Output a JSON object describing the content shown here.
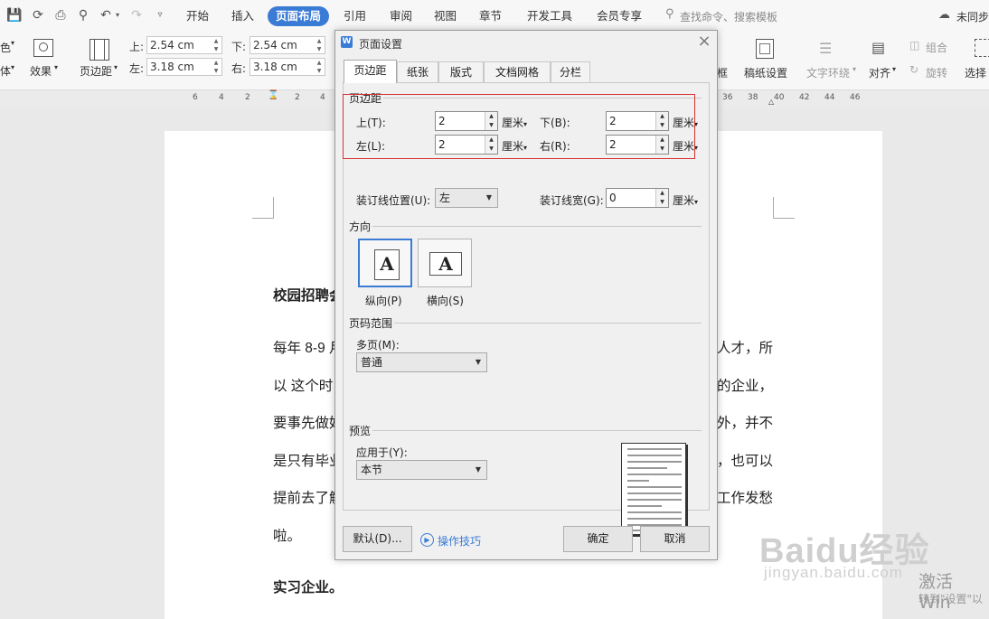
{
  "menubar": {
    "tabs": [
      "开始",
      "插入",
      "页面布局",
      "引用",
      "审阅",
      "视图",
      "章节",
      "开发工具",
      "会员专享"
    ],
    "active_tab": "页面布局",
    "search_placeholder": "查找命令、搜索模板",
    "sync_label": "未同步"
  },
  "ribbon": {
    "left_labels": [
      "色",
      "体",
      "效果"
    ],
    "margin_button": "页边距",
    "margin_top_label": "上:",
    "margin_top_value": "2.54 cm",
    "margin_bottom_label": "下:",
    "margin_bottom_value": "2.54 cm",
    "margin_left_label": "左:",
    "margin_left_value": "3.18 cm",
    "margin_right_label": "右:",
    "margin_right_value": "3.18 cm",
    "frame_label": "框",
    "manuscript_label": "稿纸设置",
    "text_wrap_label": "文字环绕",
    "align_label": "对齐",
    "group_label": "组合",
    "rotate_label": "旋转",
    "select_label": "选择"
  },
  "ruler": {
    "left_ticks": [
      "6",
      "4",
      "2",
      "2",
      "4"
    ],
    "right_ticks": [
      "36",
      "38",
      "40",
      "42",
      "44",
      "46"
    ]
  },
  "document": {
    "heading1": "校园招聘会",
    "lines": [
      "每年 8-9 月",
      "以 这个时",
      "要事先做好",
      "是只有毕业",
      "提前去了解",
      "啦。"
    ],
    "right_fragments": [
      "人才，所",
      "的企业，",
      "外，并不",
      "，也可以",
      "工作发愁"
    ],
    "heading2": "实习企业。"
  },
  "dialog": {
    "title": "页面设置",
    "tabs": [
      "页边距",
      "纸张",
      "版式",
      "文档网格",
      "分栏"
    ],
    "active_tab": "页边距",
    "margins_section": "页边距",
    "top_label": "上(T):",
    "top_value": "2",
    "bottom_label": "下(B):",
    "bottom_value": "2",
    "left_label": "左(L):",
    "left_value": "2",
    "right_label": "右(R):",
    "right_value": "2",
    "unit": "厘米",
    "gutter_pos_label": "装订线位置(U):",
    "gutter_pos_value": "左",
    "gutter_width_label": "装订线宽(G):",
    "gutter_width_value": "0",
    "orientation_section": "方向",
    "portrait_label": "纵向(P)",
    "landscape_label": "横向(S)",
    "page_range_section": "页码范围",
    "multi_pages_label": "多页(M):",
    "multi_pages_value": "普通",
    "preview_section": "预览",
    "apply_to_label": "应用于(Y):",
    "apply_to_value": "本节",
    "default_button": "默认(D)...",
    "tips_link": "操作技巧",
    "ok_button": "确定",
    "cancel_button": "取消"
  },
  "watermark": {
    "logo": "Baidu经验",
    "url": "jingyan.baidu.com",
    "activate": "激活 Win",
    "activate_sub": "转到\"设置\"以"
  }
}
